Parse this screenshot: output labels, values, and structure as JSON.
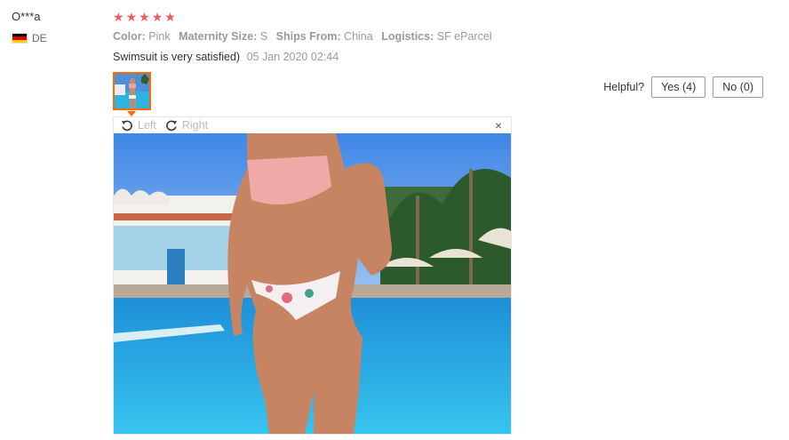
{
  "review": {
    "user": "O***a",
    "country": "DE",
    "rating": 5,
    "attributes": [
      {
        "label": "Color:",
        "value": "Pink"
      },
      {
        "label": "Maternity Size:",
        "value": "S"
      },
      {
        "label": "Ships From:",
        "value": "China"
      },
      {
        "label": "Logistics:",
        "value": "SF eParcel"
      }
    ],
    "text": "Swimsuit is very satisfied)",
    "date": "05 Jan 2020 02:44"
  },
  "helpful": {
    "label": "Helpful?",
    "yes": "Yes (4)",
    "no": "No (0)"
  },
  "viewer": {
    "rotate_left": "Left",
    "rotate_right": "Right",
    "close": "×"
  },
  "colors": {
    "star": "#f05b5b",
    "thumb_border": "#ff6a00",
    "muted_text": "#999999"
  }
}
